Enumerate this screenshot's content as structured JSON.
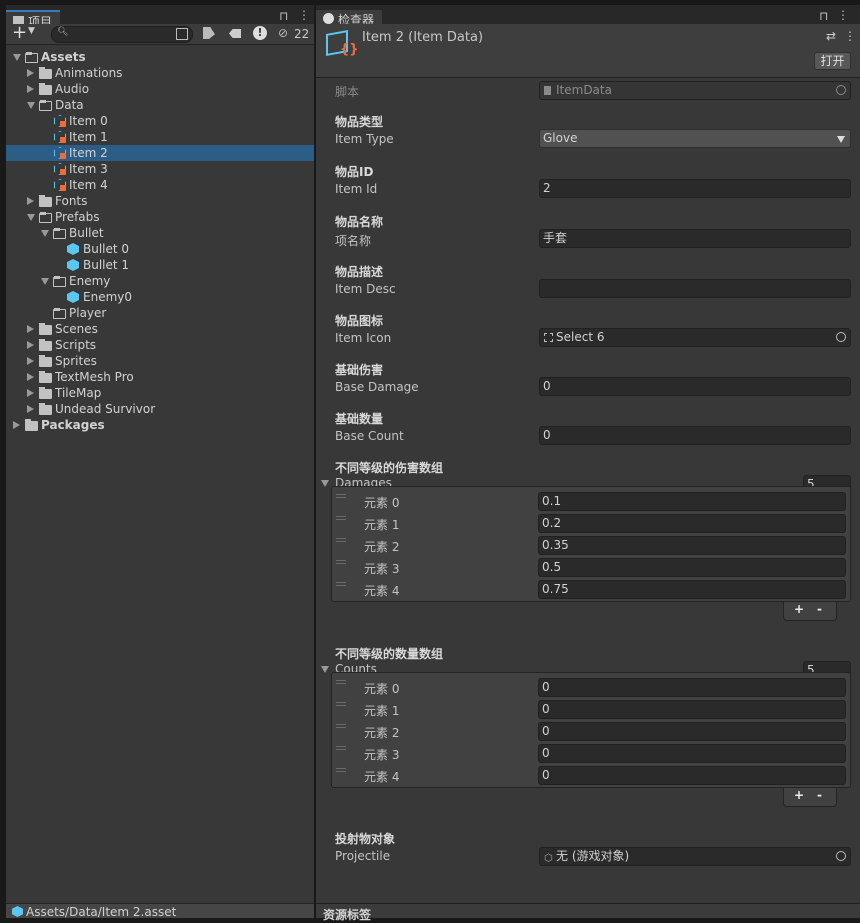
{
  "project": {
    "tab_label": "项目",
    "search_placeholder": "",
    "hidden_count": "22",
    "tree": [
      {
        "label": "Assets",
        "level": 0,
        "type": "folder",
        "expanded": true,
        "bold": true
      },
      {
        "label": "Animations",
        "level": 1,
        "type": "folder",
        "expanded": false
      },
      {
        "label": "Audio",
        "level": 1,
        "type": "folder",
        "expanded": false
      },
      {
        "label": "Data",
        "level": 1,
        "type": "folder",
        "expanded": true
      },
      {
        "label": "Item 0",
        "level": 2,
        "type": "asset"
      },
      {
        "label": "Item 1",
        "level": 2,
        "type": "asset"
      },
      {
        "label": "Item 2",
        "level": 2,
        "type": "asset",
        "selected": true
      },
      {
        "label": "Item 3",
        "level": 2,
        "type": "asset"
      },
      {
        "label": "Item 4",
        "level": 2,
        "type": "asset"
      },
      {
        "label": "Fonts",
        "level": 1,
        "type": "folder",
        "expanded": false
      },
      {
        "label": "Prefabs",
        "level": 1,
        "type": "folder",
        "expanded": true
      },
      {
        "label": "Bullet",
        "level": 2,
        "type": "folder",
        "expanded": true
      },
      {
        "label": "Bullet 0",
        "level": 3,
        "type": "prefab"
      },
      {
        "label": "Bullet 1",
        "level": 3,
        "type": "prefab"
      },
      {
        "label": "Enemy",
        "level": 2,
        "type": "folder",
        "expanded": true
      },
      {
        "label": "Enemy0",
        "level": 3,
        "type": "prefab"
      },
      {
        "label": "Player",
        "level": 2,
        "type": "folder-empty"
      },
      {
        "label": "Scenes",
        "level": 1,
        "type": "folder",
        "expanded": false
      },
      {
        "label": "Scripts",
        "level": 1,
        "type": "folder",
        "expanded": false
      },
      {
        "label": "Sprites",
        "level": 1,
        "type": "folder",
        "expanded": false
      },
      {
        "label": "TextMesh Pro",
        "level": 1,
        "type": "folder",
        "expanded": false
      },
      {
        "label": "TileMap",
        "level": 1,
        "type": "folder",
        "expanded": false
      },
      {
        "label": "Undead Survivor",
        "level": 1,
        "type": "folder",
        "expanded": false
      },
      {
        "label": "Packages",
        "level": 0,
        "type": "folder",
        "expanded": false,
        "bold": true
      }
    ],
    "footer_path": "Assets/Data/Item 2.asset"
  },
  "inspector": {
    "tab_label": "检查器",
    "title": "Item 2 (Item Data)",
    "open_button": "打开",
    "script_label": "脚本",
    "script_value": "ItemData",
    "fields": [
      {
        "header": "物品类型",
        "label": "Item Type",
        "value": "Glove",
        "kind": "dropdown"
      },
      {
        "header": "物品ID",
        "label": "Item Id",
        "value": "2",
        "kind": "text"
      },
      {
        "header": "物品名称",
        "label": "项名称",
        "value": "手套",
        "kind": "text"
      },
      {
        "header": "物品描述",
        "label": "Item Desc",
        "value": "",
        "kind": "text"
      },
      {
        "header": "物品图标",
        "label": "Item Icon",
        "value": "Select 6",
        "kind": "object"
      },
      {
        "header": "基础伤害",
        "label": "Base Damage",
        "value": "0",
        "kind": "text"
      },
      {
        "header": "基础数量",
        "label": "Base Count",
        "value": "0",
        "kind": "text"
      }
    ],
    "damages": {
      "header": "不同等级的伤害数组",
      "label": "Damages",
      "size": "5",
      "elements": [
        {
          "label": "元素 0",
          "value": "0.1"
        },
        {
          "label": "元素 1",
          "value": "0.2"
        },
        {
          "label": "元素 2",
          "value": "0.35"
        },
        {
          "label": "元素 3",
          "value": "0.5"
        },
        {
          "label": "元素 4",
          "value": "0.75"
        }
      ]
    },
    "counts": {
      "header": "不同等级的数量数组",
      "label": "Counts",
      "size": "5",
      "elements": [
        {
          "label": "元素 0",
          "value": "0"
        },
        {
          "label": "元素 1",
          "value": "0"
        },
        {
          "label": "元素 2",
          "value": "0"
        },
        {
          "label": "元素 3",
          "value": "0"
        },
        {
          "label": "元素 4",
          "value": "0"
        }
      ]
    },
    "add_label": "+",
    "remove_label": "-",
    "projectile": {
      "header": "投射物对象",
      "label": "Projectile",
      "value": "无 (游戏对象)"
    },
    "asset_labels": "资源标签"
  },
  "colors": {
    "selection": "#2c5d87",
    "accent": "#3a79bb",
    "asset_icon": "#5bc6f0",
    "script_brace": "#f26b3a"
  }
}
